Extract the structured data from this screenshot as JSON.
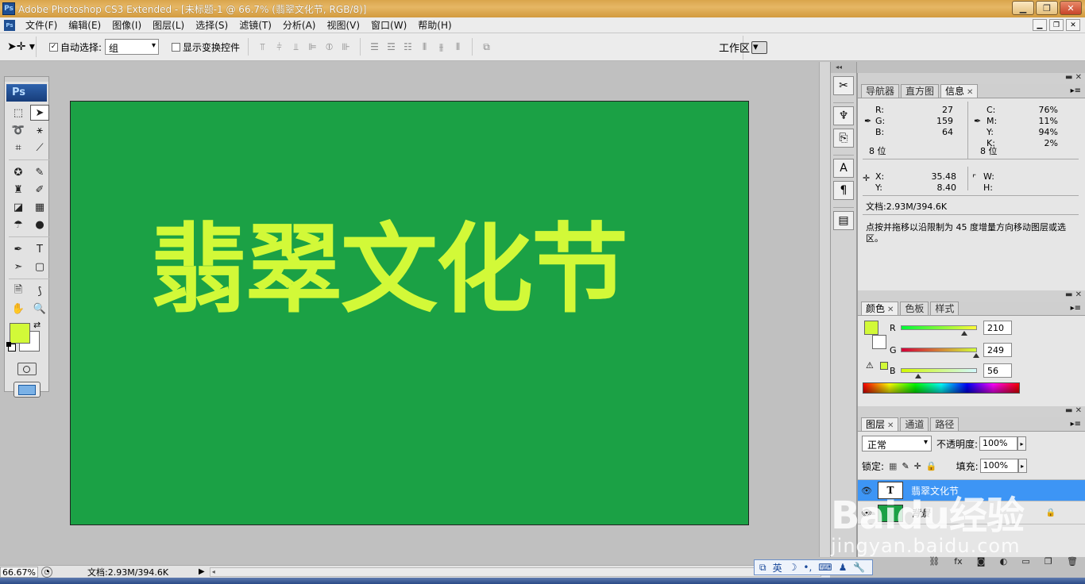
{
  "titlebar": {
    "icon": "Ps",
    "title": "Adobe Photoshop CS3 Extended - [未标题-1 @ 66.7% (翡翠文化节, RGB/8)]",
    "min_label": "▁",
    "max_label": "❐",
    "close_label": "✕"
  },
  "menu": {
    "items": [
      "文件(F)",
      "编辑(E)",
      "图像(I)",
      "图层(L)",
      "选择(S)",
      "滤镜(T)",
      "分析(A)",
      "视图(V)",
      "窗口(W)",
      "帮助(H)"
    ]
  },
  "options": {
    "auto_select_label": "自动选择:",
    "auto_select_checked": true,
    "auto_select_value": "组",
    "show_transform_label": "显示变换控件",
    "show_transform_checked": false,
    "workspace_label": "工作区"
  },
  "toolbox": {
    "logo": "Ps",
    "foreground_color": "#d2f938",
    "background_color": "#ffffff"
  },
  "canvas": {
    "background_color": "#1ba145",
    "text": "翡翠文化节",
    "text_color": "#d2f938"
  },
  "info_panel": {
    "tabs": [
      "导航器",
      "直方图",
      "信息"
    ],
    "active_tab": "信息",
    "rgb": {
      "R": "27",
      "G": "159",
      "B": "64"
    },
    "cmyk": {
      "C": "76%",
      "M": "11%",
      "Y": "94%",
      "K": "2%"
    },
    "bits_left": "8 位",
    "bits_right": "8 位",
    "xy": {
      "X": "35.48",
      "Y": "8.40"
    },
    "wh": {
      "W": "",
      "H": ""
    },
    "doc_size": "文档:2.93M/394.6K",
    "hint": "点按并拖移以沿限制为 45 度增量方向移动图层或选区。"
  },
  "color_panel": {
    "tabs": [
      "颜色",
      "色板",
      "样式"
    ],
    "active_tab": "颜色",
    "swatch": "#d2f938",
    "R": 210,
    "G": 249,
    "B": 56
  },
  "layers_panel": {
    "tabs": [
      "图层",
      "通道",
      "路径"
    ],
    "active_tab": "图层",
    "blend_mode": "正常",
    "opacity_label": "不透明度:",
    "opacity": "100%",
    "lock_label": "锁定:",
    "fill_label": "填充:",
    "fill": "100%",
    "layers": [
      {
        "name": "翡翠文化节",
        "type": "text",
        "thumb": "T",
        "selected": true,
        "locked": false
      },
      {
        "name": "背景",
        "type": "image",
        "thumb": "",
        "selected": false,
        "locked": true
      }
    ]
  },
  "statusbar": {
    "zoom": "66.67%",
    "doc": "文档:2.93M/394.6K"
  },
  "ime": {
    "lang": "英"
  },
  "watermark": {
    "brand": "Baidu经验",
    "url": "jingyan.baidu.com"
  }
}
